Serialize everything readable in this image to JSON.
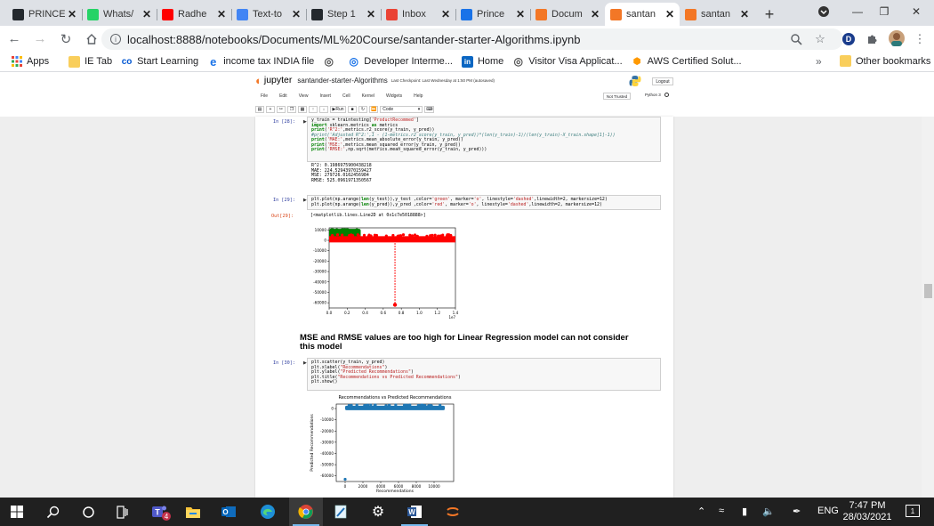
{
  "browser": {
    "tabs": [
      {
        "label": "PRINCE",
        "icon": "github-icon",
        "color": "#24292e"
      },
      {
        "label": "Whats/",
        "icon": "whatsapp-icon",
        "color": "#25d366"
      },
      {
        "label": "Radhe",
        "icon": "youtube-icon",
        "color": "#ff0000"
      },
      {
        "label": "Text-to",
        "icon": "google-drive-icon",
        "color": "#4285f4"
      },
      {
        "label": "Step 1",
        "icon": "github-icon",
        "color": "#24292e"
      },
      {
        "label": "Inbox",
        "icon": "gmail-icon",
        "color": "#ea4335"
      },
      {
        "label": "Prince",
        "icon": "k-icon",
        "color": "#1a73e8"
      },
      {
        "label": "Docum",
        "icon": "jupyter-icon",
        "color": "#f37726"
      },
      {
        "label": "santan",
        "icon": "notebook-icon",
        "color": "#f37726"
      },
      {
        "label": "santan",
        "icon": "notebook-icon",
        "color": "#f37726"
      }
    ],
    "active_tab": 8,
    "url": "localhost:8888/notebooks/Documents/ML%20Course/santander-starter-Algorithms.ipynb",
    "profile_initial": "D"
  },
  "bookmarks": {
    "items": [
      {
        "label": "Apps",
        "icon": "apps-grid-icon"
      },
      {
        "label": "IE Tab",
        "icon": "folder-icon"
      },
      {
        "label": "Start Learning",
        "icon": "coursera-icon"
      },
      {
        "label": "income tax INDIA file",
        "icon": "ie-icon"
      },
      {
        "label": "",
        "icon": "globe-icon"
      },
      {
        "label": "Developer Interme...",
        "icon": "developer-icon"
      },
      {
        "label": "Home",
        "icon": "linkedin-icon"
      },
      {
        "label": "Visitor Visa Applicat...",
        "icon": "globe-icon"
      },
      {
        "label": "AWS Certified Solut...",
        "icon": "aws-icon"
      }
    ],
    "more": "»",
    "other": "Other bookmarks"
  },
  "jupyter": {
    "logo": "jupyter",
    "notebook_name": "santander-starter-Algorithms",
    "checkpoint": "Last Checkpoint: Last Wednesday at 1:50 PM  (autosaved)",
    "logout": "Logout",
    "menu": [
      "File",
      "Edit",
      "View",
      "Insert",
      "Cell",
      "Kernel",
      "Widgets",
      "Help"
    ],
    "trusted": "Not Trusted",
    "kernel": "Python 3",
    "run_label": "Run",
    "cell_type": "Code"
  },
  "cells": {
    "c28_prompt": "In [28]:",
    "c28_code": [
      "y_train = traintesting['ProductRecommed']",
      "import sklearn.metrics as metrics",
      "print('R^2:',metrics.r2_score(y_train, y_pred))",
      "#print('Adjusted R^2:',1 - (1-metrics.r2_score(y_train, y_pred))*(len(y_train)-1)/(len(y_train)-X_train.shape[1]-1))",
      "print('MAE:',metrics.mean_absolute_error(y_train, y_pred))",
      "print('MSE:',metrics.mean_squared_error(y_train, y_pred))",
      "print('RMSE:',np.sqrt(metrics.mean_squared_error(y_train, y_pred)))"
    ],
    "c28_output": [
      "R^2: 0.1986975900438218",
      "MAE: 224.52943970159427",
      "MSE: 279726.0162456984",
      "RMSE: 525.0961971350567"
    ],
    "c29_prompt": "In [29]:",
    "c29_code": [
      "plt.plot(np.arange(len(y_test)),y_test ,color='green', marker='o', linestyle='dashed',linewidth=2, markersize=12)",
      "plt.plot(np.arange(len(y_pred)),y_pred ,color='red', marker='o', linestyle='dashed',linewidth=2, markersize=12)"
    ],
    "c29_out_prompt": "Out[29]:",
    "c29_output": "[<matplotlib.lines.Line2D at 0x1c7e5018888>]",
    "markdown": "MSE and RMSE values are too high for Linear Regression model can not consider this model",
    "c30_prompt": "In [30]:",
    "c30_code": [
      "plt.scatter(y_train, y_pred)",
      "plt.xlabel(\"Recommendations\")",
      "plt.ylabel(\"Predicted Recommendations\")",
      "plt.title(\"Recommendations vs Predicted Recommendations\")",
      "plt.show()"
    ]
  },
  "chart_data": [
    {
      "type": "line",
      "title": "",
      "xlabel": "",
      "ylabel": "",
      "x_offset_label": "1e7",
      "xlim": [
        0.0,
        1.4
      ],
      "ylim": [
        -65000,
        12000
      ],
      "xticks": [
        "0.0",
        "0.2",
        "0.4",
        "0.6",
        "0.8",
        "1.0",
        "1.2",
        "1.4"
      ],
      "yticks": [
        "10000",
        "0",
        "-10000",
        "-20000",
        "-30000",
        "-40000",
        "-50000",
        "-60000"
      ],
      "series": [
        {
          "color": "#008000",
          "x_range": [
            0.0,
            0.35
          ],
          "y_band": [
            0,
            11000
          ]
        },
        {
          "color": "#ff0000",
          "x_range": [
            0.0,
            1.4
          ],
          "y_band": [
            -2000,
            4000
          ],
          "outlier": {
            "x": 0.73,
            "y": -62000
          }
        }
      ]
    },
    {
      "type": "scatter",
      "title": "Recommendations vs Predicted Recommendations",
      "xlabel": "Recommendations",
      "ylabel": "Predicted Recommendations",
      "xlim": [
        -2500,
        30500
      ],
      "ylim": [
        -65000,
        4000
      ],
      "xticks": [
        "0",
        "2000",
        "4000",
        "6000",
        "8000",
        "10000"
      ],
      "yticks": [
        "0",
        "-10000",
        "-20000",
        "-30000",
        "-40000",
        "-50000",
        "-60000"
      ],
      "series": [
        {
          "color": "#1f77b4",
          "x_range": [
            0,
            28000
          ],
          "y_band": [
            -1500,
            2500
          ],
          "outlier": {
            "x": 0,
            "y": -63000
          }
        }
      ]
    }
  ],
  "taskbar": {
    "icons": [
      "windows-start-icon",
      "search-icon",
      "cortana-icon",
      "task-view-icon",
      "teams-icon",
      "file-explorer-icon",
      "outlook-icon",
      "edge-icon",
      "chrome-icon",
      "notepad-icon",
      "settings-icon",
      "word-icon",
      "jupyter-icon"
    ],
    "teams_badge": "4",
    "lang": "ENG",
    "time": "7:47 PM",
    "date": "28/03/2021",
    "notification_count": "1"
  }
}
